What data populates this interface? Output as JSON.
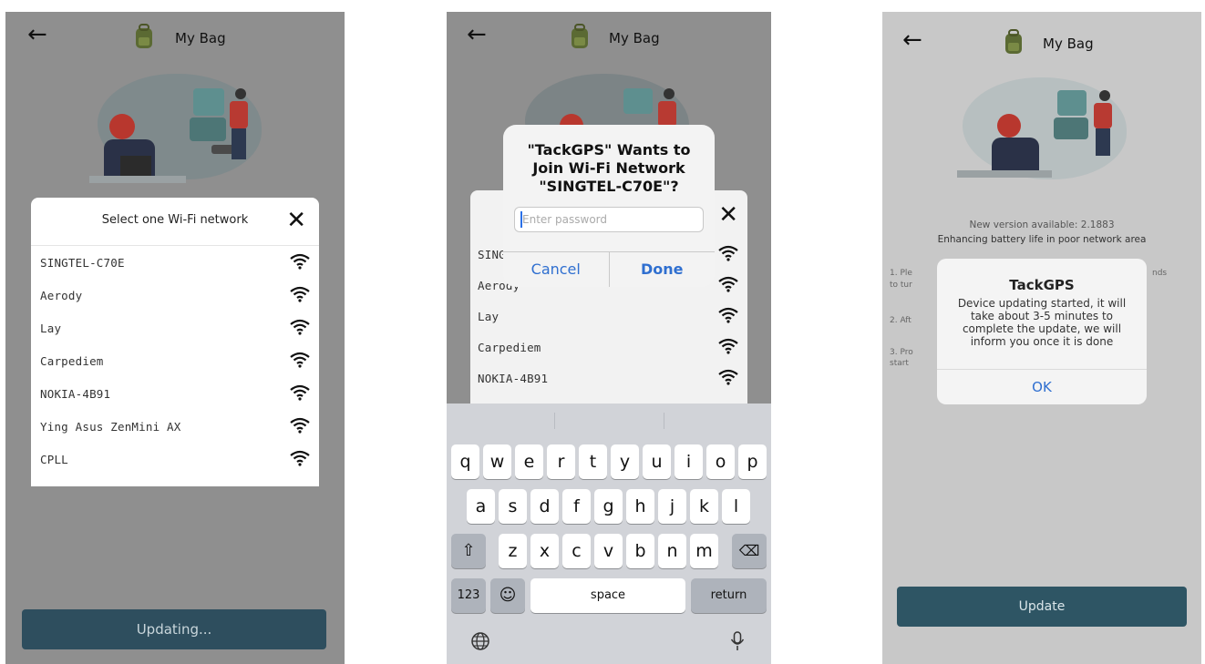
{
  "screens": [
    {
      "title": "My Bag",
      "sheet": {
        "title": "Select one Wi-Fi network",
        "networks": [
          "SINGTEL-C70E",
          "Aerody",
          "Lay",
          "Carpediem",
          "NOKIA-4B91",
          "Ying Asus ZenMini AX",
          "CPLL"
        ]
      },
      "button": "Updating..."
    },
    {
      "title": "My Bag",
      "alert": {
        "title": "\"TackGPS\" Wants to Join Wi-Fi Network \"SINGTEL-C70E\"?",
        "placeholder": "Enter password",
        "cancel": "Cancel",
        "done": "Done"
      },
      "sheet_networks": [
        "SING",
        "Aerody",
        "Lay",
        "Carpediem",
        "NOKIA-4B91"
      ],
      "keyboard": {
        "row1": [
          "q",
          "w",
          "e",
          "r",
          "t",
          "y",
          "u",
          "i",
          "o",
          "p"
        ],
        "row2": [
          "a",
          "s",
          "d",
          "f",
          "g",
          "h",
          "j",
          "k",
          "l"
        ],
        "row3": [
          "z",
          "x",
          "c",
          "v",
          "b",
          "n",
          "m"
        ],
        "numbers": "123",
        "space": "space",
        "return": "return"
      }
    },
    {
      "title": "My Bag",
      "new_version": "New version available: 2.1883",
      "enhancement": "Enhancing battery life in poor network area",
      "steps": [
        "1. Ple",
        "to tur",
        "2. Aft",
        "3. Pro",
        "start"
      ],
      "step_tail": "nds",
      "dialog": {
        "title": "TackGPS",
        "message": "Device updating started, it will take about 3-5 minutes to complete the update, we will inform you once it is done",
        "ok": "OK"
      },
      "button": "Update"
    }
  ],
  "colors": {
    "accent": "#2f6fd0",
    "button": "#2e4e5e"
  }
}
